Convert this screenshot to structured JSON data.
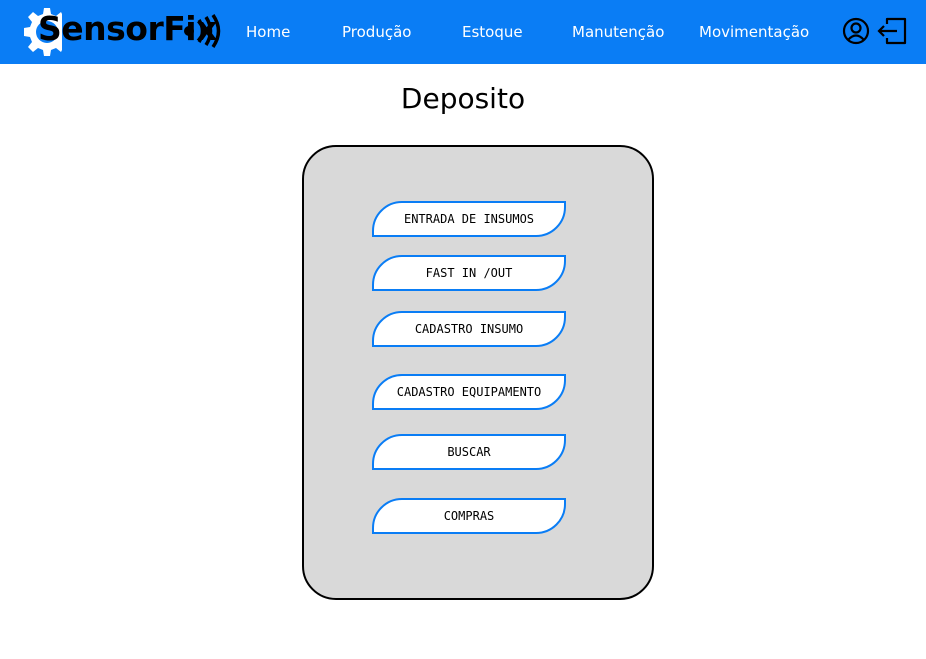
{
  "brand": {
    "name": "SensorFix",
    "colors": {
      "topbar": "#0a7df5",
      "accent_border": "#0a7df5",
      "panel_bg": "#d9d9d9"
    }
  },
  "nav": {
    "items": [
      {
        "label": "Home"
      },
      {
        "label": "Produção"
      },
      {
        "label": "Estoque"
      },
      {
        "label": "Manutenção"
      },
      {
        "label": "Movimentação"
      }
    ],
    "icons": [
      "user-icon",
      "logout-icon"
    ]
  },
  "page": {
    "title": "Deposito"
  },
  "actions": [
    {
      "label": "ENTRADA DE INSUMOS"
    },
    {
      "label": "FAST IN /OUT"
    },
    {
      "label": "CADASTRO INSUMO"
    },
    {
      "label": "CADASTRO EQUIPAMENTO"
    },
    {
      "label": "BUSCAR"
    },
    {
      "label": "COMPRAS"
    }
  ]
}
